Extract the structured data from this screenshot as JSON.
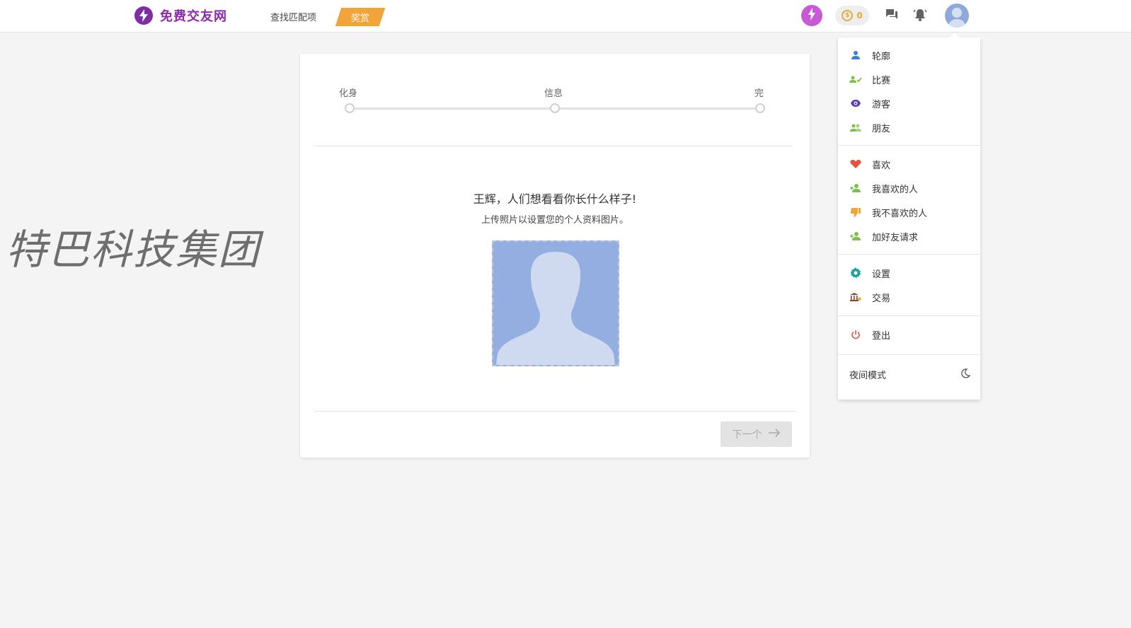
{
  "header": {
    "logo_text": "免费交友网",
    "nav_find": "查找匹配项",
    "nav_reward": "奖赏",
    "coins": "0"
  },
  "watermark": "特巴科技集团",
  "wizard": {
    "steps": [
      "化身",
      "信息",
      "完"
    ],
    "headline": "王辉，人们想看看你长什么样子!",
    "subline": "上传照片以设置您的个人资料图片。",
    "next_label": "下一个"
  },
  "menu": {
    "section1": [
      {
        "label": "轮廓",
        "icon": "person-icon",
        "color": "#3d7fd6"
      },
      {
        "label": "比赛",
        "icon": "match-icon",
        "color": "#7cbf4a"
      },
      {
        "label": "游客",
        "icon": "eye-icon",
        "color": "#5b3fb0"
      },
      {
        "label": "朋友",
        "icon": "friends-icon",
        "color": "#7cbf4a"
      }
    ],
    "section2": [
      {
        "label": "喜欢",
        "icon": "heart-icon",
        "color": "#e4533f"
      },
      {
        "label": "我喜欢的人",
        "icon": "liked-people-icon",
        "color": "#7cbf4a"
      },
      {
        "label": "我不喜欢的人",
        "icon": "thumbs-down-icon",
        "color": "#f0a43a"
      },
      {
        "label": "加好友请求",
        "icon": "friend-request-icon",
        "color": "#7cbf4a"
      }
    ],
    "section3": [
      {
        "label": "设置",
        "icon": "gear-icon",
        "color": "#1aa3a3"
      },
      {
        "label": "交易",
        "icon": "bank-icon",
        "color": "#8a4a2a"
      }
    ],
    "section4": [
      {
        "label": "登出",
        "icon": "power-icon",
        "color": "#e4533f"
      }
    ],
    "night_mode": "夜间模式"
  }
}
